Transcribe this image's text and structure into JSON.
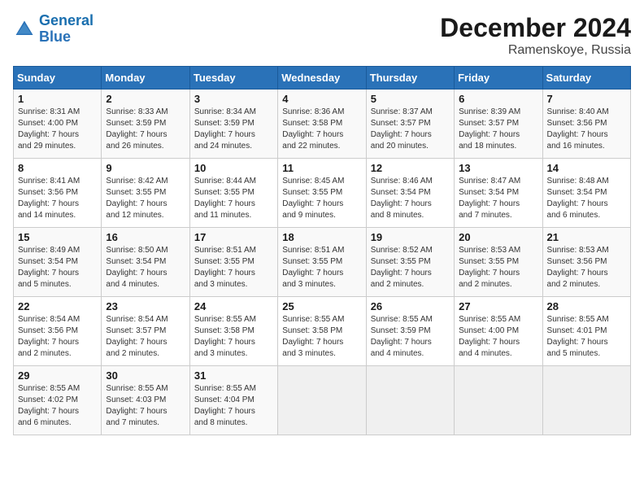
{
  "logo": {
    "text_general": "General",
    "text_blue": "Blue"
  },
  "header": {
    "title": "December 2024",
    "subtitle": "Ramenskoye, Russia"
  },
  "weekdays": [
    "Sunday",
    "Monday",
    "Tuesday",
    "Wednesday",
    "Thursday",
    "Friday",
    "Saturday"
  ],
  "weeks": [
    [
      {
        "day": "1",
        "info": "Sunrise: 8:31 AM\nSunset: 4:00 PM\nDaylight: 7 hours\nand 29 minutes."
      },
      {
        "day": "2",
        "info": "Sunrise: 8:33 AM\nSunset: 3:59 PM\nDaylight: 7 hours\nand 26 minutes."
      },
      {
        "day": "3",
        "info": "Sunrise: 8:34 AM\nSunset: 3:59 PM\nDaylight: 7 hours\nand 24 minutes."
      },
      {
        "day": "4",
        "info": "Sunrise: 8:36 AM\nSunset: 3:58 PM\nDaylight: 7 hours\nand 22 minutes."
      },
      {
        "day": "5",
        "info": "Sunrise: 8:37 AM\nSunset: 3:57 PM\nDaylight: 7 hours\nand 20 minutes."
      },
      {
        "day": "6",
        "info": "Sunrise: 8:39 AM\nSunset: 3:57 PM\nDaylight: 7 hours\nand 18 minutes."
      },
      {
        "day": "7",
        "info": "Sunrise: 8:40 AM\nSunset: 3:56 PM\nDaylight: 7 hours\nand 16 minutes."
      }
    ],
    [
      {
        "day": "8",
        "info": "Sunrise: 8:41 AM\nSunset: 3:56 PM\nDaylight: 7 hours\nand 14 minutes."
      },
      {
        "day": "9",
        "info": "Sunrise: 8:42 AM\nSunset: 3:55 PM\nDaylight: 7 hours\nand 12 minutes."
      },
      {
        "day": "10",
        "info": "Sunrise: 8:44 AM\nSunset: 3:55 PM\nDaylight: 7 hours\nand 11 minutes."
      },
      {
        "day": "11",
        "info": "Sunrise: 8:45 AM\nSunset: 3:55 PM\nDaylight: 7 hours\nand 9 minutes."
      },
      {
        "day": "12",
        "info": "Sunrise: 8:46 AM\nSunset: 3:54 PM\nDaylight: 7 hours\nand 8 minutes."
      },
      {
        "day": "13",
        "info": "Sunrise: 8:47 AM\nSunset: 3:54 PM\nDaylight: 7 hours\nand 7 minutes."
      },
      {
        "day": "14",
        "info": "Sunrise: 8:48 AM\nSunset: 3:54 PM\nDaylight: 7 hours\nand 6 minutes."
      }
    ],
    [
      {
        "day": "15",
        "info": "Sunrise: 8:49 AM\nSunset: 3:54 PM\nDaylight: 7 hours\nand 5 minutes."
      },
      {
        "day": "16",
        "info": "Sunrise: 8:50 AM\nSunset: 3:54 PM\nDaylight: 7 hours\nand 4 minutes."
      },
      {
        "day": "17",
        "info": "Sunrise: 8:51 AM\nSunset: 3:55 PM\nDaylight: 7 hours\nand 3 minutes."
      },
      {
        "day": "18",
        "info": "Sunrise: 8:51 AM\nSunset: 3:55 PM\nDaylight: 7 hours\nand 3 minutes."
      },
      {
        "day": "19",
        "info": "Sunrise: 8:52 AM\nSunset: 3:55 PM\nDaylight: 7 hours\nand 2 minutes."
      },
      {
        "day": "20",
        "info": "Sunrise: 8:53 AM\nSunset: 3:55 PM\nDaylight: 7 hours\nand 2 minutes."
      },
      {
        "day": "21",
        "info": "Sunrise: 8:53 AM\nSunset: 3:56 PM\nDaylight: 7 hours\nand 2 minutes."
      }
    ],
    [
      {
        "day": "22",
        "info": "Sunrise: 8:54 AM\nSunset: 3:56 PM\nDaylight: 7 hours\nand 2 minutes."
      },
      {
        "day": "23",
        "info": "Sunrise: 8:54 AM\nSunset: 3:57 PM\nDaylight: 7 hours\nand 2 minutes."
      },
      {
        "day": "24",
        "info": "Sunrise: 8:55 AM\nSunset: 3:58 PM\nDaylight: 7 hours\nand 3 minutes."
      },
      {
        "day": "25",
        "info": "Sunrise: 8:55 AM\nSunset: 3:58 PM\nDaylight: 7 hours\nand 3 minutes."
      },
      {
        "day": "26",
        "info": "Sunrise: 8:55 AM\nSunset: 3:59 PM\nDaylight: 7 hours\nand 4 minutes."
      },
      {
        "day": "27",
        "info": "Sunrise: 8:55 AM\nSunset: 4:00 PM\nDaylight: 7 hours\nand 4 minutes."
      },
      {
        "day": "28",
        "info": "Sunrise: 8:55 AM\nSunset: 4:01 PM\nDaylight: 7 hours\nand 5 minutes."
      }
    ],
    [
      {
        "day": "29",
        "info": "Sunrise: 8:55 AM\nSunset: 4:02 PM\nDaylight: 7 hours\nand 6 minutes."
      },
      {
        "day": "30",
        "info": "Sunrise: 8:55 AM\nSunset: 4:03 PM\nDaylight: 7 hours\nand 7 minutes."
      },
      {
        "day": "31",
        "info": "Sunrise: 8:55 AM\nSunset: 4:04 PM\nDaylight: 7 hours\nand 8 minutes."
      },
      {
        "day": "",
        "info": ""
      },
      {
        "day": "",
        "info": ""
      },
      {
        "day": "",
        "info": ""
      },
      {
        "day": "",
        "info": ""
      }
    ]
  ]
}
